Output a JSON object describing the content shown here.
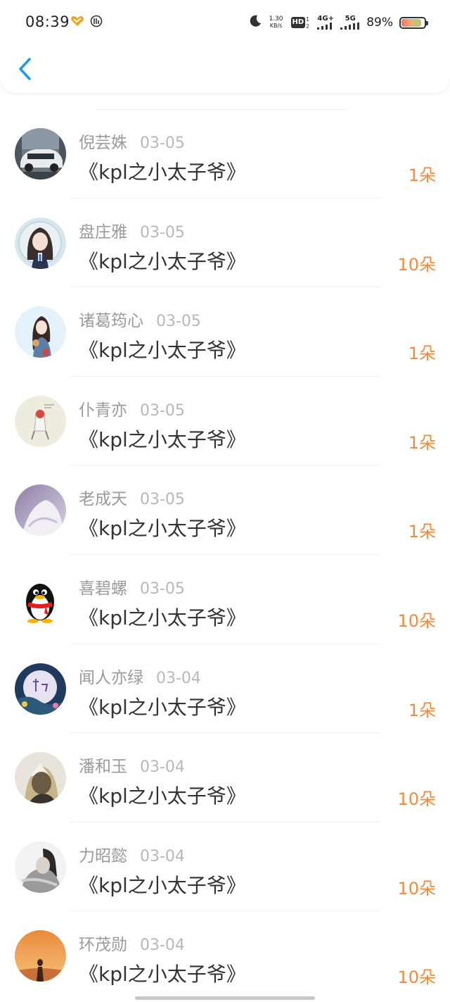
{
  "status_bar": {
    "time": "08:39",
    "net_speed_value": "1.30",
    "net_speed_unit": "KB/s",
    "hd_label": "HD",
    "net_4g_label": "4G+",
    "net_5g_label": "5G",
    "battery_percent": "89%",
    "battery_level": 0.89
  },
  "header": {
    "back_icon": "chevron-left-icon",
    "accent_color": "#2196f3"
  },
  "colors": {
    "gift_color": "#ef8a3e",
    "name_color": "#9a9a9a"
  },
  "items": [
    {
      "name": "倪芸姝",
      "date": "03-05",
      "title": "《kpl之小太子爷》",
      "gift": "1朵"
    },
    {
      "name": "盘庄雅",
      "date": "03-05",
      "title": "《kpl之小太子爷》",
      "gift": "10朵"
    },
    {
      "name": "诸葛筠心",
      "date": "03-05",
      "title": "《kpl之小太子爷》",
      "gift": "1朵"
    },
    {
      "name": "仆青亦",
      "date": "03-05",
      "title": "《kpl之小太子爷》",
      "gift": "1朵"
    },
    {
      "name": "老成天",
      "date": "03-05",
      "title": "《kpl之小太子爷》",
      "gift": "1朵"
    },
    {
      "name": "喜碧螺",
      "date": "03-05",
      "title": "《kpl之小太子爷》",
      "gift": "10朵"
    },
    {
      "name": "闻人亦绿",
      "date": "03-04",
      "title": "《kpl之小太子爷》",
      "gift": "1朵"
    },
    {
      "name": "潘和玉",
      "date": "03-04",
      "title": "《kpl之小太子爷》",
      "gift": "10朵"
    },
    {
      "name": "力昭懿",
      "date": "03-04",
      "title": "《kpl之小太子爷》",
      "gift": "10朵"
    },
    {
      "name": "环茂勋",
      "date": "03-04",
      "title": "《kpl之小太子爷》",
      "gift": "10朵"
    }
  ]
}
